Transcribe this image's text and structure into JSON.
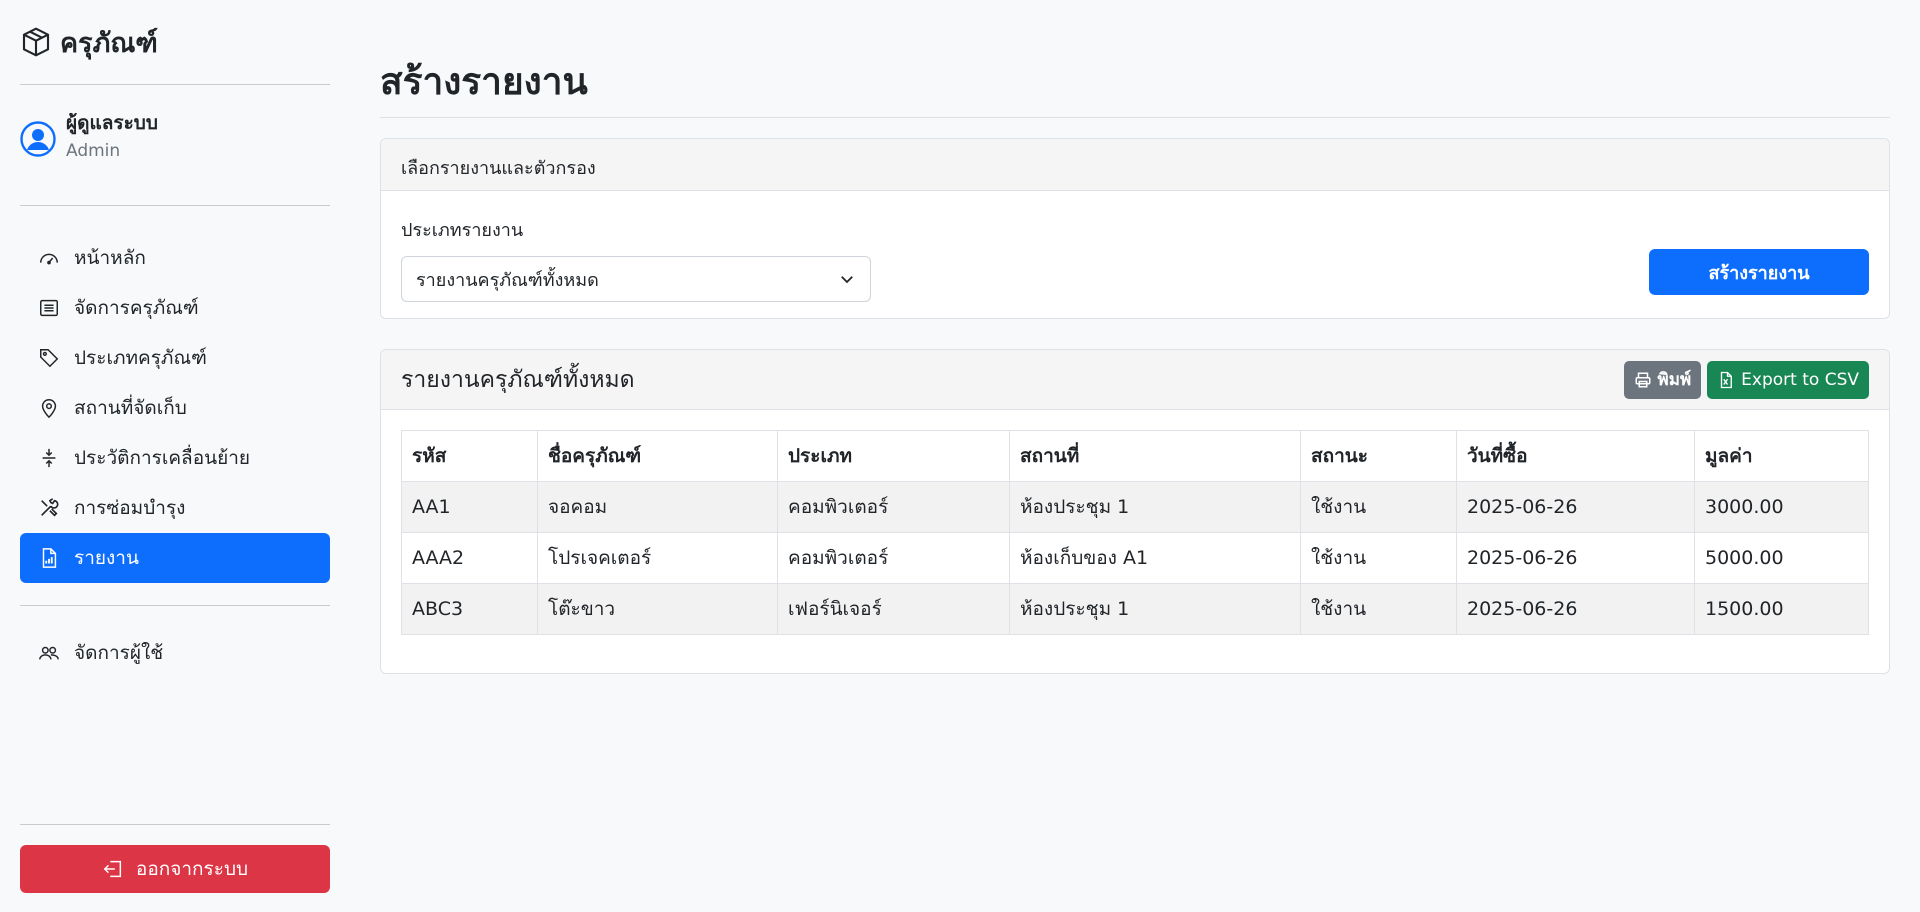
{
  "brand": {
    "title": "ครุภัณฑ์"
  },
  "user": {
    "name": "ผู้ดูแลระบบ",
    "role": "Admin"
  },
  "nav": {
    "items": [
      {
        "label": "หน้าหลัก",
        "icon": "speedometer-icon"
      },
      {
        "label": "จัดการครุภัณฑ์",
        "icon": "list-icon"
      },
      {
        "label": "ประเภทครุภัณฑ์",
        "icon": "tags-icon"
      },
      {
        "label": "สถานที่จัดเก็บ",
        "icon": "geo-pin-icon"
      },
      {
        "label": "ประวัติการเคลื่อนย้าย",
        "icon": "arrows-vertical-icon"
      },
      {
        "label": "การซ่อมบำรุง",
        "icon": "tools-icon"
      },
      {
        "label": "รายงาน",
        "icon": "report-file-icon",
        "active": true
      }
    ],
    "admin_items": [
      {
        "label": "จัดการผู้ใช้",
        "icon": "people-icon"
      }
    ],
    "logout_label": "ออกจากระบบ"
  },
  "page": {
    "title": "สร้างรายงาน"
  },
  "filter": {
    "header": "เลือกรายงานและตัวกรอง",
    "type_label": "ประเภทรายงาน",
    "type_value": "รายงานครุภัณฑ์ทั้งหมด",
    "generate_label": "สร้างรายงาน"
  },
  "report": {
    "title": "รายงานครุภัณฑ์ทั้งหมด",
    "print_label": "พิมพ์",
    "csv_label": "Export to CSV",
    "columns": [
      "รหัส",
      "ชื่อครุภัณฑ์",
      "ประเภท",
      "สถานที่",
      "สถานะ",
      "วันที่ซื้อ",
      "มูลค่า"
    ],
    "rows": [
      [
        "AA1",
        "จอคอม",
        "คอมพิวเตอร์",
        "ห้องประชุม 1",
        "ใช้งาน",
        "2025-06-26",
        "3000.00"
      ],
      [
        "AAA2",
        "โปรเจคเตอร์",
        "คอมพิวเตอร์",
        "ห้องเก็บของ A1",
        "ใช้งาน",
        "2025-06-26",
        "5000.00"
      ],
      [
        "ABC3",
        "โต๊ะขาว",
        "เฟอร์นิเจอร์",
        "ห้องประชุม 1",
        "ใช้งาน",
        "2025-06-26",
        "1500.00"
      ]
    ]
  },
  "colors": {
    "primary": "#0d6efd",
    "danger": "#dc3545",
    "success": "#198754",
    "secondary": "#6c757d"
  }
}
